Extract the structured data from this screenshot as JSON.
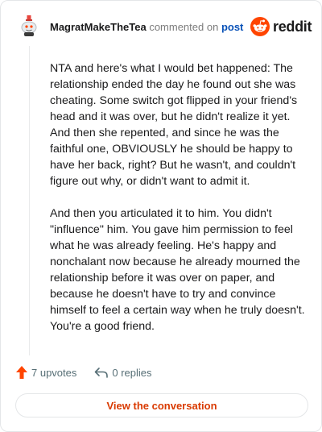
{
  "header": {
    "username": "MagratMakeTheTea",
    "action_text": "commented on",
    "post_link": "post",
    "brand": "reddit"
  },
  "comment": {
    "paragraphs": [
      "NTA and here's what I would bet happened: The relationship ended the day he found out she was cheating. Some switch got flipped in your friend's head and it was over, but he didn't realize it yet. And then she repented, and since he was the faithful one, OBVIOUSLY he should be happy to have her back, right? But he wasn't, and couldn't figure out why, or didn't want to admit it.",
      "And then you articulated it to him. You didn't \"influence\" him. You gave him permission to feel what he was already feeling. He's happy and nonchalant now because he already mourned the relationship before it was over on paper, and because he doesn't have to try and convince himself to feel a certain way when he truly doesn't. You're a good friend."
    ]
  },
  "actions": {
    "upvotes": "7 upvotes",
    "replies": "0 replies"
  },
  "view_button": "View the conversation",
  "colors": {
    "upvote": "#ff4500",
    "link": "#0a52b8",
    "button_text": "#d93a00",
    "muted": "#576f76"
  }
}
